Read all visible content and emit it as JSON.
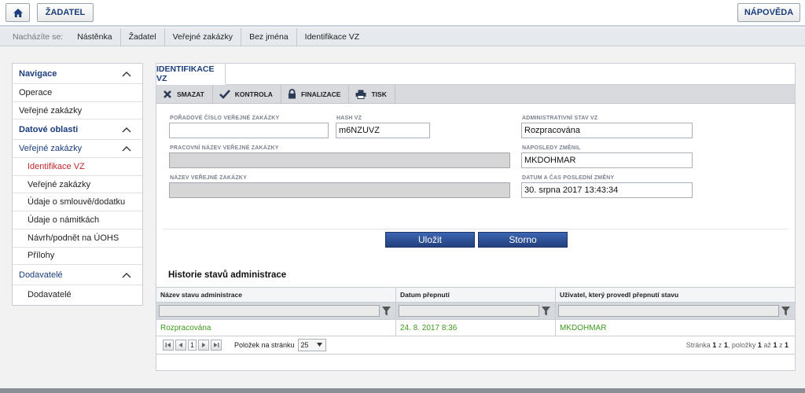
{
  "header": {
    "home_icon": "home-icon",
    "zadatel_label": "ŽADATEL",
    "napoveda_label": "NÁPOVĚDA"
  },
  "breadcrumb": {
    "prefix": "Nacházíte se:",
    "items": [
      "Nástěnka",
      "Žadatel",
      "Veřejné zakázky",
      "Bez jména",
      "Identifikace VZ"
    ]
  },
  "sidebar": {
    "sections": [
      {
        "label": "Navigace"
      },
      {
        "label": "Datové oblasti"
      },
      {
        "label": "Dodavatelé"
      }
    ],
    "nav_items": [
      "Operace",
      "Veřejné zakázky"
    ],
    "sub_head": "Veřejné zakázky",
    "sub_items": [
      "Identifikace VZ",
      "Veřejné zakázky",
      "Údaje o smlouvě/dodatku",
      "Údaje o námitkách",
      "Návrh/podnět na ÚOHS",
      "Přílohy"
    ],
    "dodavatele_item": "Dodavatelé"
  },
  "main": {
    "tab_label": "IDENTIFIKACE VZ",
    "toolbar": {
      "smazat": "SMAZAT",
      "kontrola": "KONTROLA",
      "finalizace": "FINALIZACE",
      "tisk": "TISK"
    },
    "form": {
      "poradove_label": "POŘADOVÉ ČÍSLO VEŘEJNÉ ZAKÁZKY",
      "poradove_value": "",
      "hash_label": "HASH VZ",
      "hash_value": "m6NZUVZ",
      "adm_stav_label": "ADMINISTRATIVNÍ STAV VZ",
      "adm_stav_value": "Rozpracována",
      "pracovni_label": "PRACOVNÍ NÁZEV VEŘEJNÉ ZAKÁZKY",
      "pracovni_value": "",
      "naposledy_label": "NAPOSLEDY ZMĚNIL",
      "naposledy_value": "MKDOHMAR",
      "nazev_label": "NÁZEV VEŘEJNÉ ZAKÁZKY",
      "nazev_value": "",
      "datum_label": "DATUM A ČAS POSLEDNÍ ZMĚNY",
      "datum_value": "30. srpna 2017 13:43:34"
    },
    "buttons": {
      "ulozit": "Uložit",
      "storno": "Storno"
    },
    "history": {
      "title": "Historie stavů administrace",
      "columns": [
        "Název stavu administrace",
        "Datum přepnutí",
        "Uživatel, který provedl přepnutí stavu"
      ],
      "rows": [
        [
          "Rozpracována",
          "24. 8. 2017 8:36",
          "MKDOHMAR"
        ]
      ]
    },
    "pager": {
      "current_page": "1",
      "per_page_label": "Položek na stránku",
      "per_page_value": "25",
      "info_prefix": "Stránka",
      "info_page": "1",
      "info_of": "z",
      "info_pages": "1",
      "info_items_label": ", položky",
      "info_from": "1",
      "info_to_word": "až",
      "info_to": "1",
      "info_total_of": "z",
      "info_total": "1"
    }
  },
  "colors": {
    "accent": "#1a3d7c",
    "active_link": "#c0272d",
    "history_text": "#3e9b1e",
    "primary_button": "#2b4c8f"
  }
}
